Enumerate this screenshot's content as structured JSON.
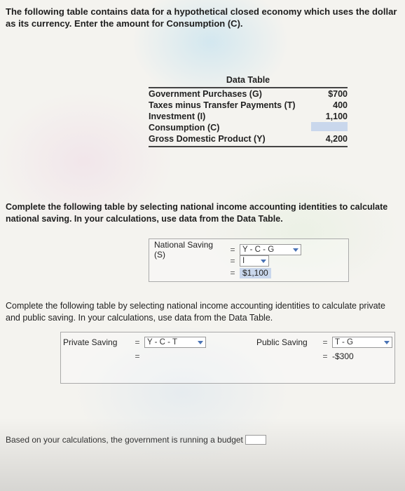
{
  "intro": {
    "part1": "The following table contains data for a hypothetical ",
    "bold": "closed",
    "part2": " economy which uses the dollar as its currency. Enter the amount for Consumption (C)."
  },
  "data_table": {
    "title": "Data Table",
    "rows": [
      {
        "label": "Government Purchases (G)",
        "value": "$700"
      },
      {
        "label": "Taxes minus Transfer Payments (T)",
        "value": "400"
      },
      {
        "label": "Investment (I)",
        "value": "1,100"
      },
      {
        "label": "Consumption (C)",
        "value": ""
      },
      {
        "label": "Gross Domestic Product (Y)",
        "value": "4,200"
      }
    ]
  },
  "instructions": {
    "national": "Complete the following table by selecting national income accounting identities to calculate national saving. In your calculations, use data from the Data Table.",
    "private_public": "Complete the following table by selecting national income accounting identities to calculate private and public saving. In your calculations, use data from the Data Table."
  },
  "national_saving": {
    "label": "National Saving (S)",
    "eq": "=",
    "formula1": "Y - C - G",
    "formula2": "I",
    "result": "$1,100"
  },
  "private_saving": {
    "label": "Private Saving",
    "eq": "=",
    "formula": "Y - C - T",
    "result": ""
  },
  "public_saving": {
    "label": "Public Saving",
    "eq": "=",
    "formula": "T - G",
    "result": "-$300"
  },
  "footer": {
    "text": "Based on your calculations, the government is running a budget"
  }
}
